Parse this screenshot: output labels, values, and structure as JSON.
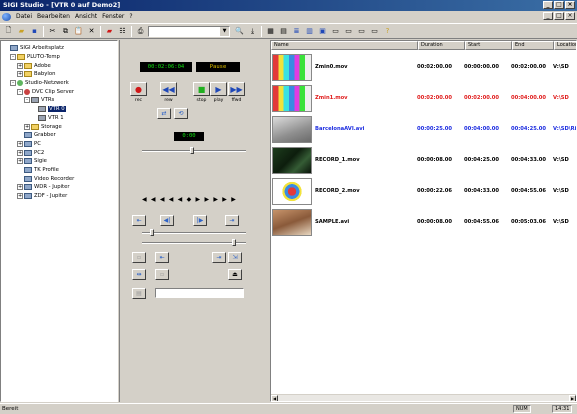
{
  "window": {
    "title": "SIGI Studio - [VTR 0 auf Demo2]"
  },
  "menu": {
    "items": [
      "Datei",
      "Bearbeiten",
      "Ansicht",
      "Fenster",
      "?"
    ]
  },
  "tree": {
    "items": [
      {
        "label": "SIGI Arbeitsplatz",
        "level": 0,
        "icon": "computer-icon",
        "expander": ""
      },
      {
        "label": "PLUTO-Temp",
        "level": 1,
        "icon": "folder-icon",
        "expander": "-"
      },
      {
        "label": "Adobe",
        "level": 2,
        "icon": "folder-icon",
        "expander": "+"
      },
      {
        "label": "Babylon",
        "level": 2,
        "icon": "folder-icon",
        "expander": "+"
      },
      {
        "label": "Studio-Netzwerk",
        "level": 1,
        "icon": "network-icon",
        "expander": "-"
      },
      {
        "label": "DVC Clip Server",
        "level": 2,
        "icon": "clip-server-icon",
        "expander": "-"
      },
      {
        "label": "VTRs",
        "level": 3,
        "icon": "vtr-icon",
        "expander": "-"
      },
      {
        "label": "VTR 0",
        "level": 4,
        "icon": "vtr-icon",
        "expander": "",
        "selected": true
      },
      {
        "label": "VTR 1",
        "level": 4,
        "icon": "vtr-icon",
        "expander": ""
      },
      {
        "label": "Storage",
        "level": 3,
        "icon": "folder-icon",
        "expander": "+"
      },
      {
        "label": "Grabber",
        "level": 2,
        "icon": "computer-icon",
        "expander": ""
      },
      {
        "label": "PC",
        "level": 2,
        "icon": "computer-icon",
        "expander": "+"
      },
      {
        "label": "PC2",
        "level": 2,
        "icon": "computer-icon",
        "expander": "+"
      },
      {
        "label": "Sigie",
        "level": 2,
        "icon": "computer-icon",
        "expander": "+"
      },
      {
        "label": "TK Profile",
        "level": 2,
        "icon": "computer-icon",
        "expander": ""
      },
      {
        "label": "Video Recorder",
        "level": 2,
        "icon": "computer-icon",
        "expander": ""
      },
      {
        "label": "WDR - Jupiter",
        "level": 2,
        "icon": "computer-icon",
        "expander": "+"
      },
      {
        "label": "ZDF - Jupiter",
        "level": 2,
        "icon": "computer-icon",
        "expander": "+"
      }
    ]
  },
  "vtr": {
    "timecode": "00:02:06:04",
    "status": "Pause",
    "counter": "0:00",
    "transport": [
      {
        "name": "rec-button",
        "glyph": "●",
        "label": "rec",
        "color": "#d01818"
      },
      {
        "name": "rew-button",
        "glyph": "◀◀",
        "label": "rew",
        "color": "#1f48b8"
      },
      {
        "name": "stop-button",
        "glyph": "■",
        "label": "stop",
        "color": "#20b020"
      },
      {
        "name": "play-button",
        "glyph": "▶",
        "label": "play",
        "color": "#1f48b8"
      },
      {
        "name": "ffwd-button",
        "glyph": "▶▶",
        "label": "ffwd",
        "color": "#1f48b8"
      }
    ],
    "shuttle": "◀ ◀ ◀ ◀ ◀ ◆ ▶ ▶ ▶ ▶ ▶"
  },
  "list": {
    "columns": [
      "Name",
      "Duration",
      "Start",
      "End",
      "Location"
    ],
    "rows": [
      {
        "name": "Zmin0.mov",
        "duration": "00:02:00.00",
        "start": "00:00:00.00",
        "end": "00:02:00.00",
        "location": "V:\\SD",
        "color": "#000000"
      },
      {
        "name": "Zmin1.mov",
        "duration": "00:02:00.00",
        "start": "00:02:00.00",
        "end": "00:04:00.00",
        "location": "V:\\SD",
        "color": "#e01c1c"
      },
      {
        "name": "BarcelonaAVI.avi",
        "duration": "00:00:25.00",
        "start": "00:04:00.00",
        "end": "00:04:25.00",
        "location": "V:\\SD\\Ri",
        "color": "#1c2ce0"
      },
      {
        "name": "RECORD_1.mov",
        "duration": "00:00:08.00",
        "start": "00:04:25.00",
        "end": "00:04:33.00",
        "location": "V:\\SD",
        "color": "#000000"
      },
      {
        "name": "RECORD_2.mov",
        "duration": "00:00:22.06",
        "start": "00:04:33.00",
        "end": "00:04:55.06",
        "location": "V:\\SD",
        "color": "#000000"
      },
      {
        "name": "SAMPLE.avi",
        "duration": "00:00:08.00",
        "start": "00:04:55.06",
        "end": "00:05:03.06",
        "location": "V:\\SD",
        "color": "#000000"
      }
    ]
  },
  "status": {
    "text": "Bereit",
    "num": "NUM",
    "time": "14:31"
  }
}
